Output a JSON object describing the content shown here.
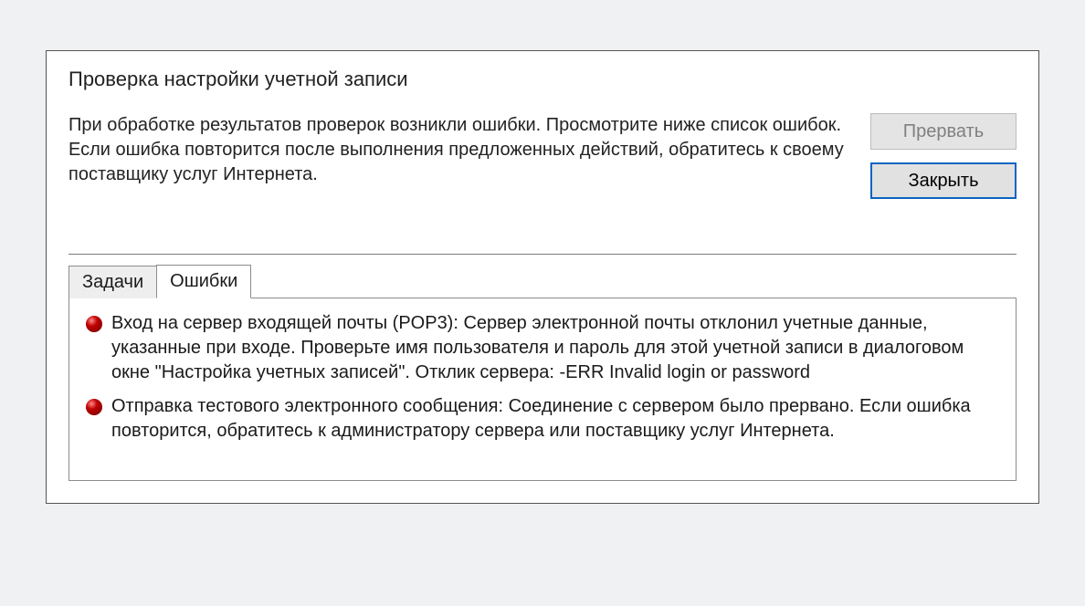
{
  "dialog": {
    "title": "Проверка настройки учетной записи",
    "message": "При обработке результатов проверок возникли ошибки. Просмотрите ниже список ошибок. Если ошибка повторится после выполнения предложенных действий, обратитесь к своему поставщику услуг Интернета.",
    "buttons": {
      "abort": "Прервать",
      "close": "Закрыть"
    },
    "tabs": {
      "tasks": "Задачи",
      "errors": "Ошибки",
      "active": "errors"
    },
    "errors": [
      {
        "text": "Вход на сервер входящей почты (POP3): Сервер электронной почты отклонил учетные данные, указанные при входе. Проверьте имя пользователя и пароль для этой учетной записи в диалоговом окне \"Настройка учетных записей\".  Отклик сервера: -ERR Invalid login or password"
      },
      {
        "text": "Отправка тестового электронного сообщения: Соединение с сервером было прервано. Если ошибка повторится, обратитесь к администратору сервера или поставщику услуг Интернета."
      }
    ]
  }
}
